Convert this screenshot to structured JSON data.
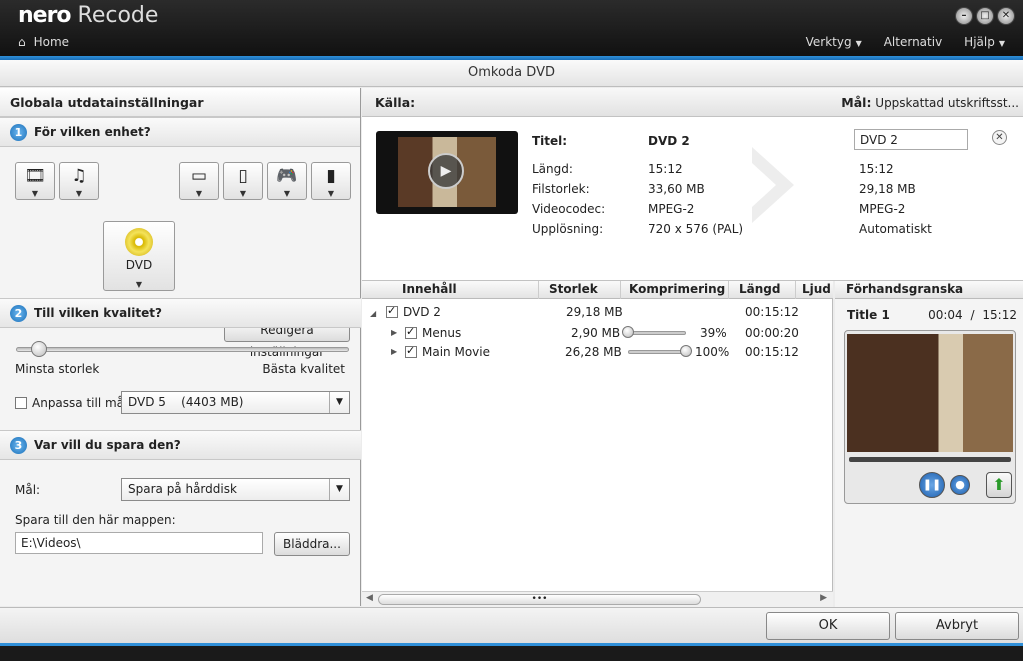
{
  "app": {
    "brand_bold": "nero",
    "brand_name": "Recode",
    "home": "Home"
  },
  "menu": {
    "tools": "Verktyg",
    "alternatives": "Alternativ",
    "help": "Hjälp"
  },
  "page_title": "Omkoda DVD",
  "left": {
    "title": "Globala utdatainställningar",
    "section1": {
      "num": "1",
      "title": "För vilken enhet?"
    },
    "selected_device": "DVD",
    "edit_settings": "Redigera inställningar",
    "section2": {
      "num": "2",
      "title": "Till vilken kvalitet?"
    },
    "quality_min": "Minsta storlek",
    "quality_max": "Bästa kvalitet",
    "quality_level": 0.07,
    "fit_label": "Anpassa till mål:",
    "fit_value": "DVD 5    (4403 MB)",
    "section3": {
      "num": "3",
      "title": "Var vill du spara den?"
    },
    "target_label": "Mål:",
    "target_value": "Spara på hårddisk",
    "folder_label": "Spara till den här mappen:",
    "folder_value": "E:\\Videos\\",
    "browse": "Bläddra..."
  },
  "source": {
    "header": "Källa:",
    "target_header": "Mål:",
    "target_estimate": "Uppskattad utskriftsst...",
    "labels": {
      "title": "Titel:",
      "length": "Längd:",
      "filesize": "Filstorlek:",
      "codec": "Videocodec:",
      "resolution": "Upplösning:"
    },
    "src": {
      "title": "DVD 2",
      "length": "15:12",
      "filesize": "33,60 MB",
      "codec": "MPEG-2",
      "resolution": "720 x 576 (PAL)"
    },
    "dst": {
      "title": "DVD 2",
      "length": "15:12",
      "filesize": "29,18 MB",
      "codec": "MPEG-2",
      "resolution": "Automatiskt"
    }
  },
  "table": {
    "headers": [
      "Innehåll",
      "Storlek",
      "Komprimering",
      "Längd",
      "Ljud"
    ],
    "rows": [
      {
        "name": "DVD 2",
        "size": "29,18 MB",
        "comp": "",
        "len": "00:15:12"
      },
      {
        "name": "Menus",
        "size": "2,90 MB",
        "comp": "39%",
        "len": "00:00:20",
        "level": 0.0
      },
      {
        "name": "Main Movie",
        "size": "26,28 MB",
        "comp": "100%",
        "len": "00:15:12",
        "level": 1.0
      }
    ]
  },
  "preview": {
    "header": "Förhandsgranska",
    "title": "Title 1",
    "current": "00:04",
    "sep": "/",
    "total": "15:12"
  },
  "buttons": {
    "ok": "OK",
    "cancel": "Avbryt"
  }
}
